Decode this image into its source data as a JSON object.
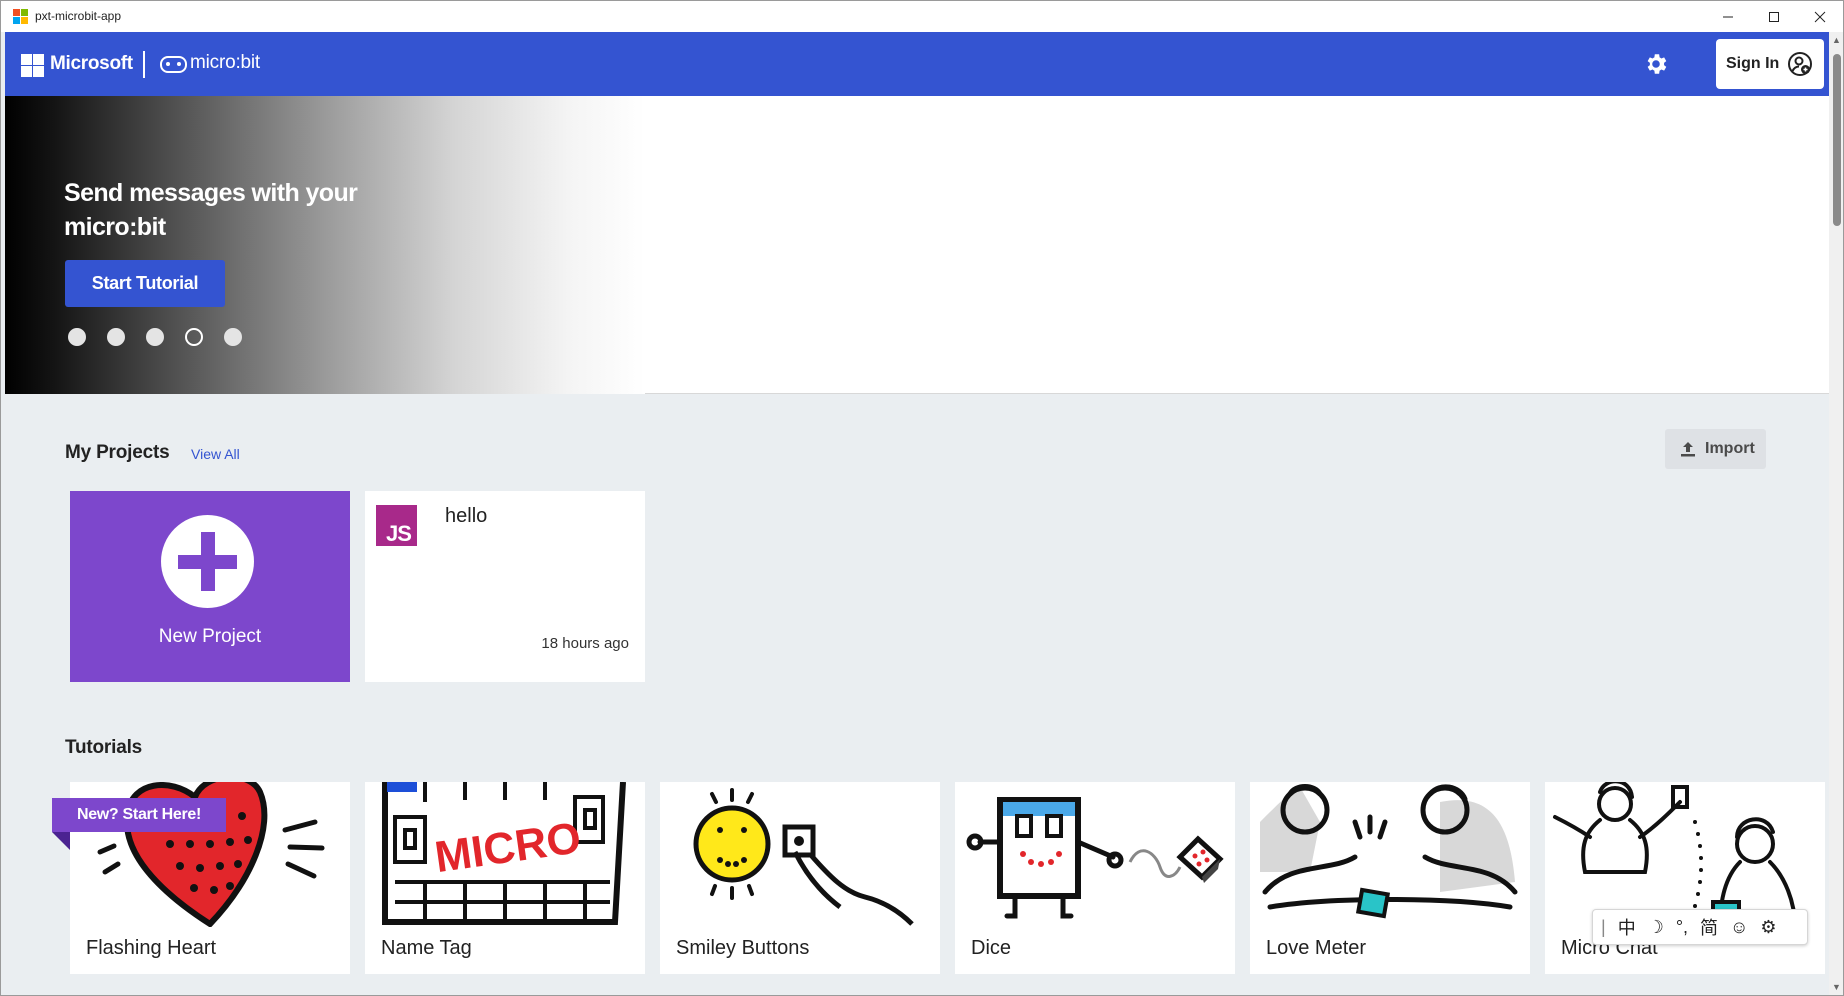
{
  "window": {
    "title": "pxt-microbit-app",
    "minimize": "—",
    "maximize": "☐",
    "close": "✕"
  },
  "header": {
    "ms_name": "Microsoft",
    "mb_name": "micro:bit",
    "signin_label": "Sign In",
    "brand_color": "#3454d1"
  },
  "hero": {
    "title": "Send messages with your micro:bit",
    "button_label": "Start Tutorial",
    "slide_count": 5,
    "active_slide": 4
  },
  "projects": {
    "title": "My Projects",
    "view_all": "View All",
    "import_label": "Import",
    "new_project_label": "New Project",
    "items": [
      {
        "badge": "JS",
        "name": "hello",
        "time": "18 hours ago"
      }
    ]
  },
  "tutorials": {
    "title": "Tutorials",
    "badge": "New? Start Here!",
    "items": [
      {
        "label": "Flashing Heart"
      },
      {
        "label": "Name Tag",
        "image_text": "MICRO"
      },
      {
        "label": "Smiley Buttons"
      },
      {
        "label": "Dice"
      },
      {
        "label": "Love Meter"
      },
      {
        "label": "Micro Chat"
      }
    ]
  },
  "ime": {
    "cursor": "|",
    "lang": "中",
    "mode": "☽",
    "punct": "°,",
    "script": "简",
    "emoji": "☺",
    "settings": "⚙"
  }
}
